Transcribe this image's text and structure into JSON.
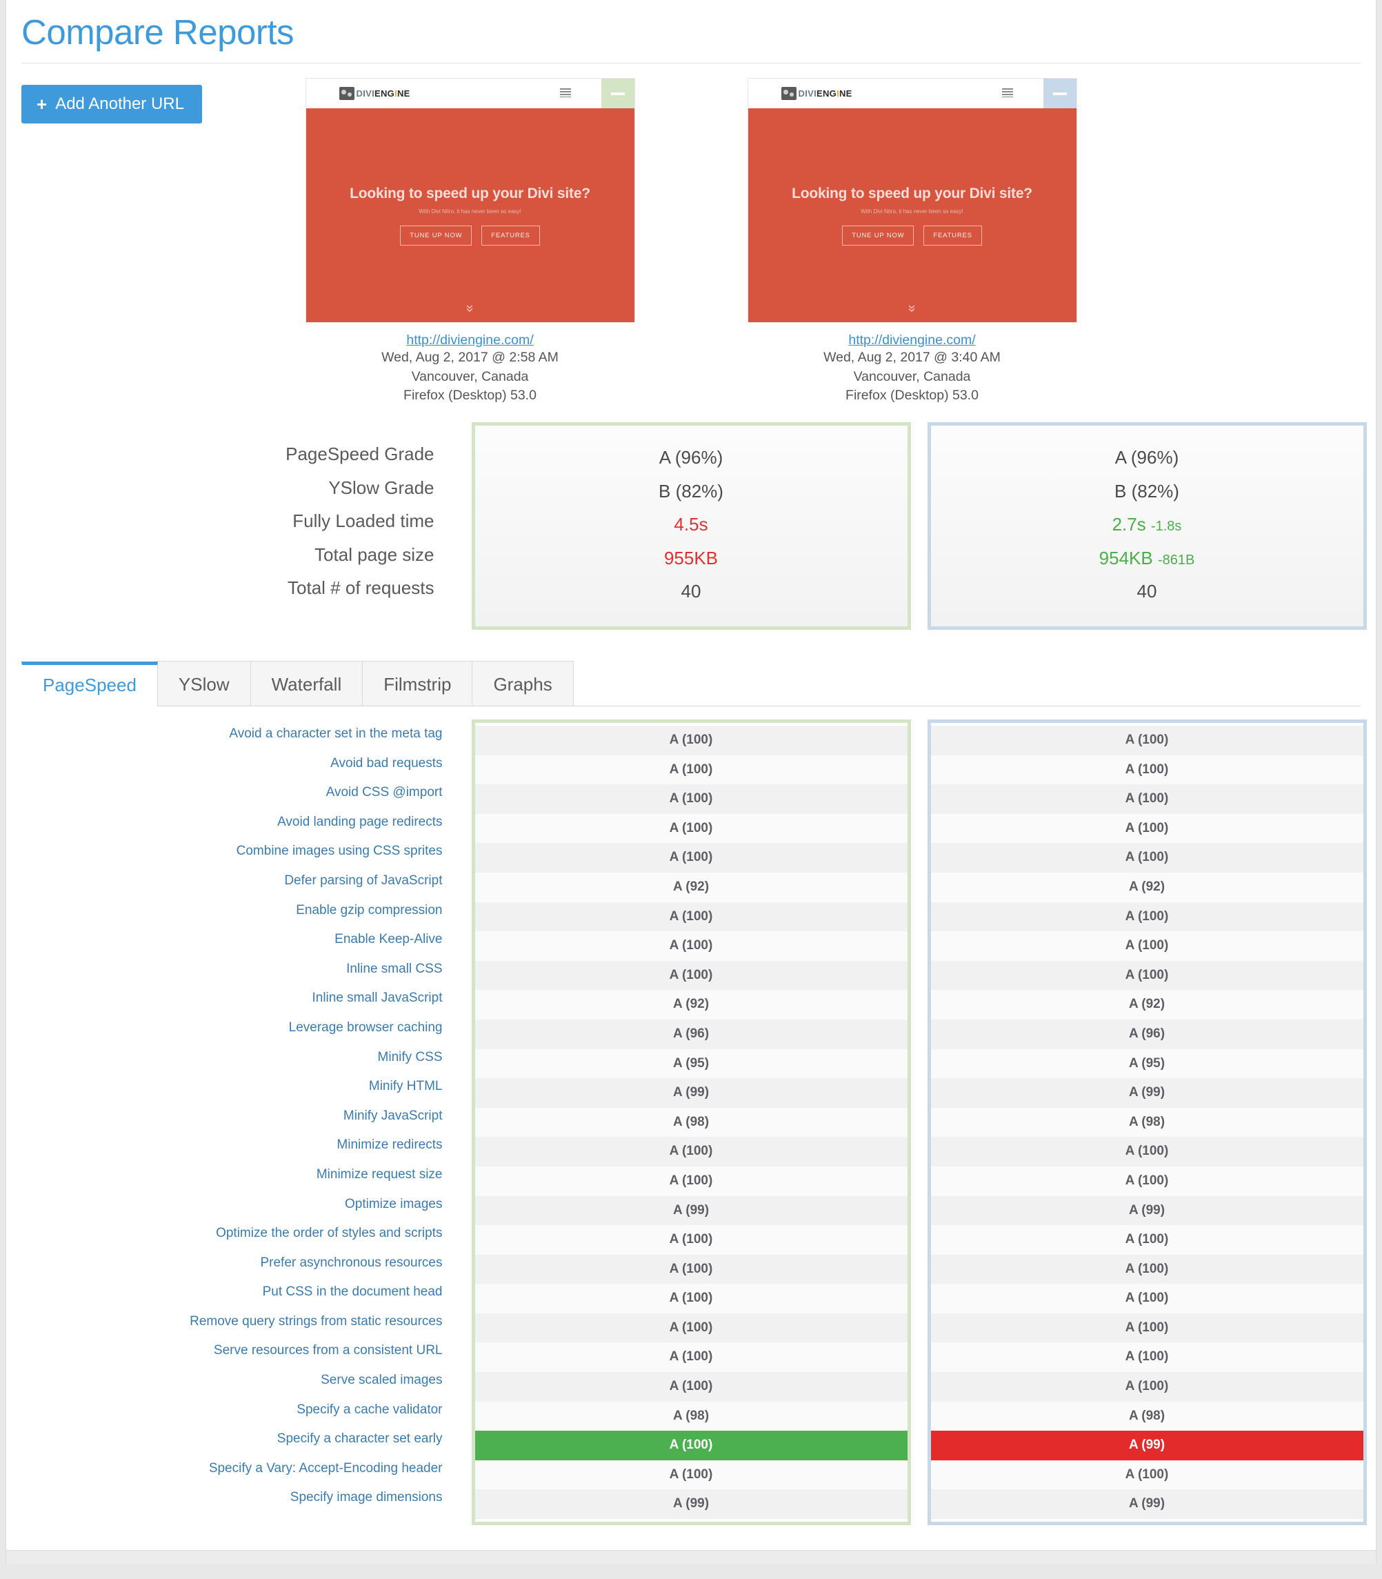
{
  "header": {
    "title": "Compare Reports",
    "add_url_label": "Add Another URL",
    "plus_icon": "+"
  },
  "reports": [
    {
      "url": "http://diviengine.com/",
      "timestamp": "Wed, Aug 2, 2017 @ 2:58 AM",
      "location": "Vancouver, Canada",
      "browser": "Firefox (Desktop) 53.0",
      "accent": "#d3e5c4",
      "thumbnail": {
        "logo_part1": "DIVI",
        "logo_part2": "ENG",
        "logo_dot": "I",
        "logo_part3": "NE",
        "hero_heading": "Looking to speed up your Divi site?",
        "hero_sub": "With Divi Nitro, it has never been so easy!",
        "btn1": "TUNE UP NOW",
        "btn2": "FEATURES",
        "chevron": "»"
      }
    },
    {
      "url": "http://diviengine.com/",
      "timestamp": "Wed, Aug 2, 2017 @ 3:40 AM",
      "location": "Vancouver, Canada",
      "browser": "Firefox (Desktop) 53.0",
      "accent": "#c7d8ea",
      "thumbnail": {
        "logo_part1": "DIVI",
        "logo_part2": "ENG",
        "logo_dot": "I",
        "logo_part3": "NE",
        "hero_heading": "Looking to speed up your Divi site?",
        "hero_sub": "With Divi Nitro, it has never been so easy!",
        "btn1": "TUNE UP NOW",
        "btn2": "FEATURES",
        "chevron": "»"
      }
    }
  ],
  "summary": {
    "labels": [
      "PageSpeed Grade",
      "YSlow Grade",
      "Fully Loaded time",
      "Total page size",
      "Total # of requests"
    ],
    "left": [
      {
        "value": "A (96%)",
        "color": "default",
        "delta": ""
      },
      {
        "value": "B (82%)",
        "color": "default",
        "delta": ""
      },
      {
        "value": "4.5s",
        "color": "red",
        "delta": ""
      },
      {
        "value": "955KB",
        "color": "red",
        "delta": ""
      },
      {
        "value": "40",
        "color": "default",
        "delta": ""
      }
    ],
    "right": [
      {
        "value": "A (96%)",
        "color": "default",
        "delta": ""
      },
      {
        "value": "B (82%)",
        "color": "default",
        "delta": ""
      },
      {
        "value": "2.7s",
        "color": "green",
        "delta": "-1.8s"
      },
      {
        "value": "954KB",
        "color": "green",
        "delta": "-861B"
      },
      {
        "value": "40",
        "color": "default",
        "delta": ""
      }
    ]
  },
  "tabs": [
    {
      "label": "PageSpeed",
      "active": true
    },
    {
      "label": "YSlow",
      "active": false
    },
    {
      "label": "Waterfall",
      "active": false
    },
    {
      "label": "Filmstrip",
      "active": false
    },
    {
      "label": "Graphs",
      "active": false
    }
  ],
  "rules": [
    {
      "name": "Avoid a character set in the meta tag",
      "left": "A (100)",
      "right": "A (100)",
      "left_hl": "",
      "right_hl": ""
    },
    {
      "name": "Avoid bad requests",
      "left": "A (100)",
      "right": "A (100)",
      "left_hl": "",
      "right_hl": ""
    },
    {
      "name": "Avoid CSS @import",
      "left": "A (100)",
      "right": "A (100)",
      "left_hl": "",
      "right_hl": ""
    },
    {
      "name": "Avoid landing page redirects",
      "left": "A (100)",
      "right": "A (100)",
      "left_hl": "",
      "right_hl": ""
    },
    {
      "name": "Combine images using CSS sprites",
      "left": "A (100)",
      "right": "A (100)",
      "left_hl": "",
      "right_hl": ""
    },
    {
      "name": "Defer parsing of JavaScript",
      "left": "A (92)",
      "right": "A (92)",
      "left_hl": "",
      "right_hl": ""
    },
    {
      "name": "Enable gzip compression",
      "left": "A (100)",
      "right": "A (100)",
      "left_hl": "",
      "right_hl": ""
    },
    {
      "name": "Enable Keep-Alive",
      "left": "A (100)",
      "right": "A (100)",
      "left_hl": "",
      "right_hl": ""
    },
    {
      "name": "Inline small CSS",
      "left": "A (100)",
      "right": "A (100)",
      "left_hl": "",
      "right_hl": ""
    },
    {
      "name": "Inline small JavaScript",
      "left": "A (92)",
      "right": "A (92)",
      "left_hl": "",
      "right_hl": ""
    },
    {
      "name": "Leverage browser caching",
      "left": "A (96)",
      "right": "A (96)",
      "left_hl": "",
      "right_hl": ""
    },
    {
      "name": "Minify CSS",
      "left": "A (95)",
      "right": "A (95)",
      "left_hl": "",
      "right_hl": ""
    },
    {
      "name": "Minify HTML",
      "left": "A (99)",
      "right": "A (99)",
      "left_hl": "",
      "right_hl": ""
    },
    {
      "name": "Minify JavaScript",
      "left": "A (98)",
      "right": "A (98)",
      "left_hl": "",
      "right_hl": ""
    },
    {
      "name": "Minimize redirects",
      "left": "A (100)",
      "right": "A (100)",
      "left_hl": "",
      "right_hl": ""
    },
    {
      "name": "Minimize request size",
      "left": "A (100)",
      "right": "A (100)",
      "left_hl": "",
      "right_hl": ""
    },
    {
      "name": "Optimize images",
      "left": "A (99)",
      "right": "A (99)",
      "left_hl": "",
      "right_hl": ""
    },
    {
      "name": "Optimize the order of styles and scripts",
      "left": "A (100)",
      "right": "A (100)",
      "left_hl": "",
      "right_hl": ""
    },
    {
      "name": "Prefer asynchronous resources",
      "left": "A (100)",
      "right": "A (100)",
      "left_hl": "",
      "right_hl": ""
    },
    {
      "name": "Put CSS in the document head",
      "left": "A (100)",
      "right": "A (100)",
      "left_hl": "",
      "right_hl": ""
    },
    {
      "name": "Remove query strings from static resources",
      "left": "A (100)",
      "right": "A (100)",
      "left_hl": "",
      "right_hl": ""
    },
    {
      "name": "Serve resources from a consistent URL",
      "left": "A (100)",
      "right": "A (100)",
      "left_hl": "",
      "right_hl": ""
    },
    {
      "name": "Serve scaled images",
      "left": "A (100)",
      "right": "A (100)",
      "left_hl": "",
      "right_hl": ""
    },
    {
      "name": "Specify a cache validator",
      "left": "A (98)",
      "right": "A (98)",
      "left_hl": "",
      "right_hl": ""
    },
    {
      "name": "Specify a character set early",
      "left": "A (100)",
      "right": "A (99)",
      "left_hl": "green",
      "right_hl": "red"
    },
    {
      "name": "Specify a Vary: Accept-Encoding header",
      "left": "A (100)",
      "right": "A (100)",
      "left_hl": "",
      "right_hl": ""
    },
    {
      "name": "Specify image dimensions",
      "left": "A (99)",
      "right": "A (99)",
      "left_hl": "",
      "right_hl": ""
    }
  ]
}
